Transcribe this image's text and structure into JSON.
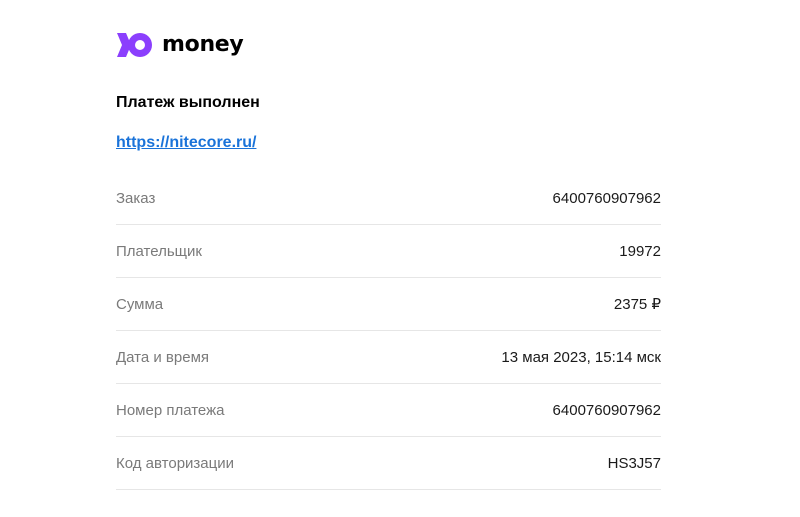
{
  "brand": {
    "logo_icon": "yoomoney-logo-icon",
    "name": "money",
    "color": "#8b3ffd"
  },
  "receipt": {
    "title": "Платеж выполнен",
    "link": "https://nitecore.ru/",
    "link_color": "#1a73d9",
    "rows": [
      {
        "label": "Заказ",
        "value": "6400760907962"
      },
      {
        "label": "Плательщик",
        "value": "19972"
      },
      {
        "label": "Сумма",
        "value": "2375 ₽"
      },
      {
        "label": "Дата и время",
        "value": "13 мая 2023, 15:14 мск"
      },
      {
        "label": "Номер платежа",
        "value": "6400760907962"
      },
      {
        "label": "Код авторизации",
        "value": "HS3J57"
      }
    ]
  }
}
